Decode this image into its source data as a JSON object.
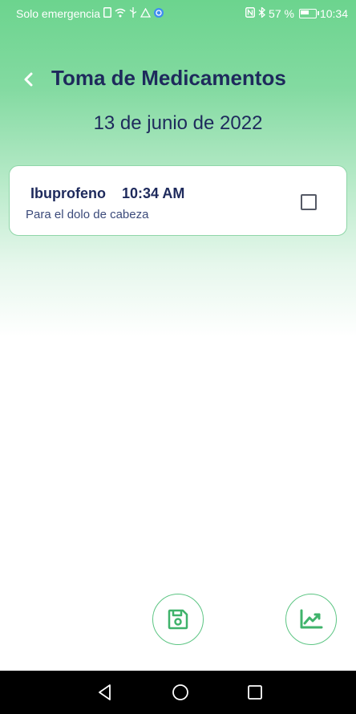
{
  "status_bar": {
    "carrier": "Solo emergencia",
    "battery_percent": "57 %",
    "time": "10:34"
  },
  "header": {
    "title": "Toma de Medicamentos",
    "date": "13 de junio de 2022"
  },
  "medications": [
    {
      "name": "Ibuprofeno",
      "time": "10:34 AM",
      "note": "Para el dolo de cabeza",
      "checked": false
    }
  ],
  "colors": {
    "accent_green": "#5cc583",
    "title_navy": "#1e2a5c"
  },
  "icons": {
    "back": "chevron-left-icon",
    "save": "floppy-disk-icon",
    "chart": "line-chart-icon"
  }
}
